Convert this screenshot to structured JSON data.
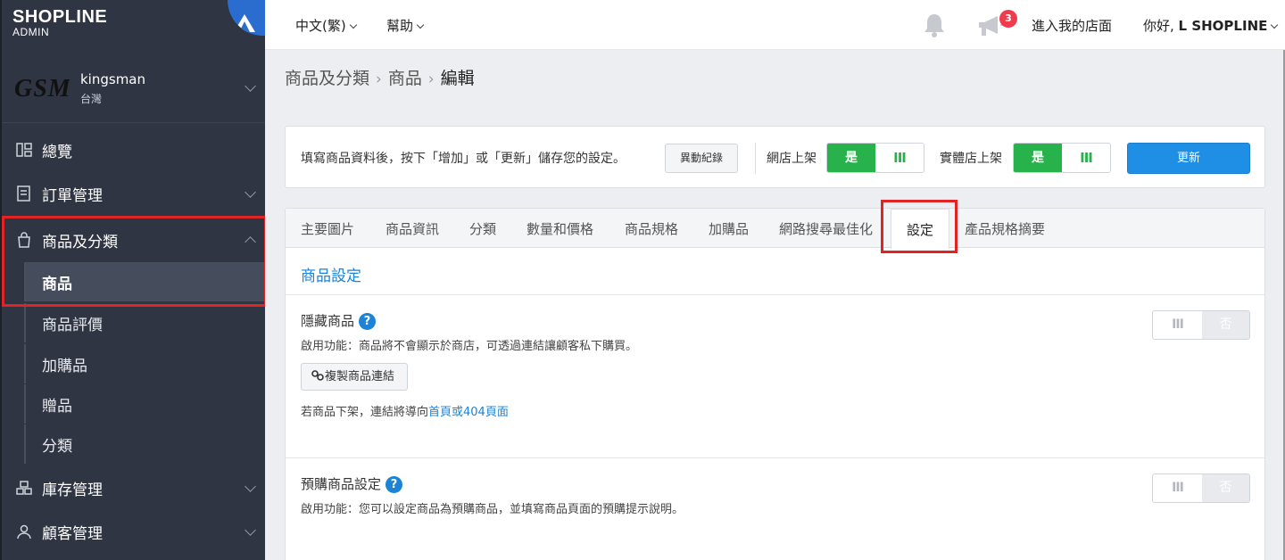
{
  "brand": {
    "logo_main": "SHOPLINE",
    "logo_sub": "ADMIN"
  },
  "shop": {
    "logo_text": "GSM",
    "name": "kingsman",
    "region": "台灣"
  },
  "sidebar": {
    "items": [
      {
        "label": "總覽",
        "icon": "dashboard-icon"
      },
      {
        "label": "訂單管理",
        "icon": "order-icon"
      },
      {
        "label": "商品及分類",
        "icon": "bag-icon"
      },
      {
        "label": "庫存管理",
        "icon": "inventory-icon"
      },
      {
        "label": "顧客管理",
        "icon": "user-icon"
      }
    ],
    "sub_items": [
      {
        "label": "商品"
      },
      {
        "label": "商品評價"
      },
      {
        "label": "加購品"
      },
      {
        "label": "贈品"
      },
      {
        "label": "分類"
      }
    ]
  },
  "topbar": {
    "language": "中文(繁)",
    "help": "幫助",
    "notification_count": "3",
    "store_link": "進入我的店面",
    "greeting": "你好, ",
    "user": "L SHOPLINE"
  },
  "breadcrumb": {
    "items": [
      "商品及分類",
      "商品"
    ],
    "current": "編輯"
  },
  "actionbar": {
    "hint": "填寫商品資料後，按下「增加」或「更新」儲存您的設定。",
    "history_button": "異動紀錄",
    "online_label": "網店上架",
    "retail_label": "實體店上架",
    "yes": "是",
    "bars": "III",
    "update_button": "更新"
  },
  "tabs": [
    {
      "label": "主要圖片"
    },
    {
      "label": "商品資訊"
    },
    {
      "label": "分類"
    },
    {
      "label": "數量和價格"
    },
    {
      "label": "商品規格"
    },
    {
      "label": "加購品"
    },
    {
      "label": "網路搜尋最佳化"
    },
    {
      "label": "設定"
    },
    {
      "label": "產品規格摘要"
    }
  ],
  "settings": {
    "section_title": "商品設定",
    "hidden": {
      "title": "隱藏商品",
      "desc": "啟用功能：商品將不會顯示於商店，可透過連結讓顧客私下購買。",
      "copy_button": "複製商品連結",
      "note_prefix": "若商品下架，連結將導向",
      "note_link": "首頁或404頁面"
    },
    "preorder": {
      "title": "預購商品設定",
      "desc": "啟用功能：您可以設定商品為預購商品，並填寫商品頁面的預購提示說明。"
    },
    "toggle_bars": "III",
    "toggle_no": "否"
  },
  "colors": {
    "sidebar": "#2f3542",
    "accent": "#1c83d6",
    "green": "#28b24b",
    "highlight": "#e02424"
  }
}
